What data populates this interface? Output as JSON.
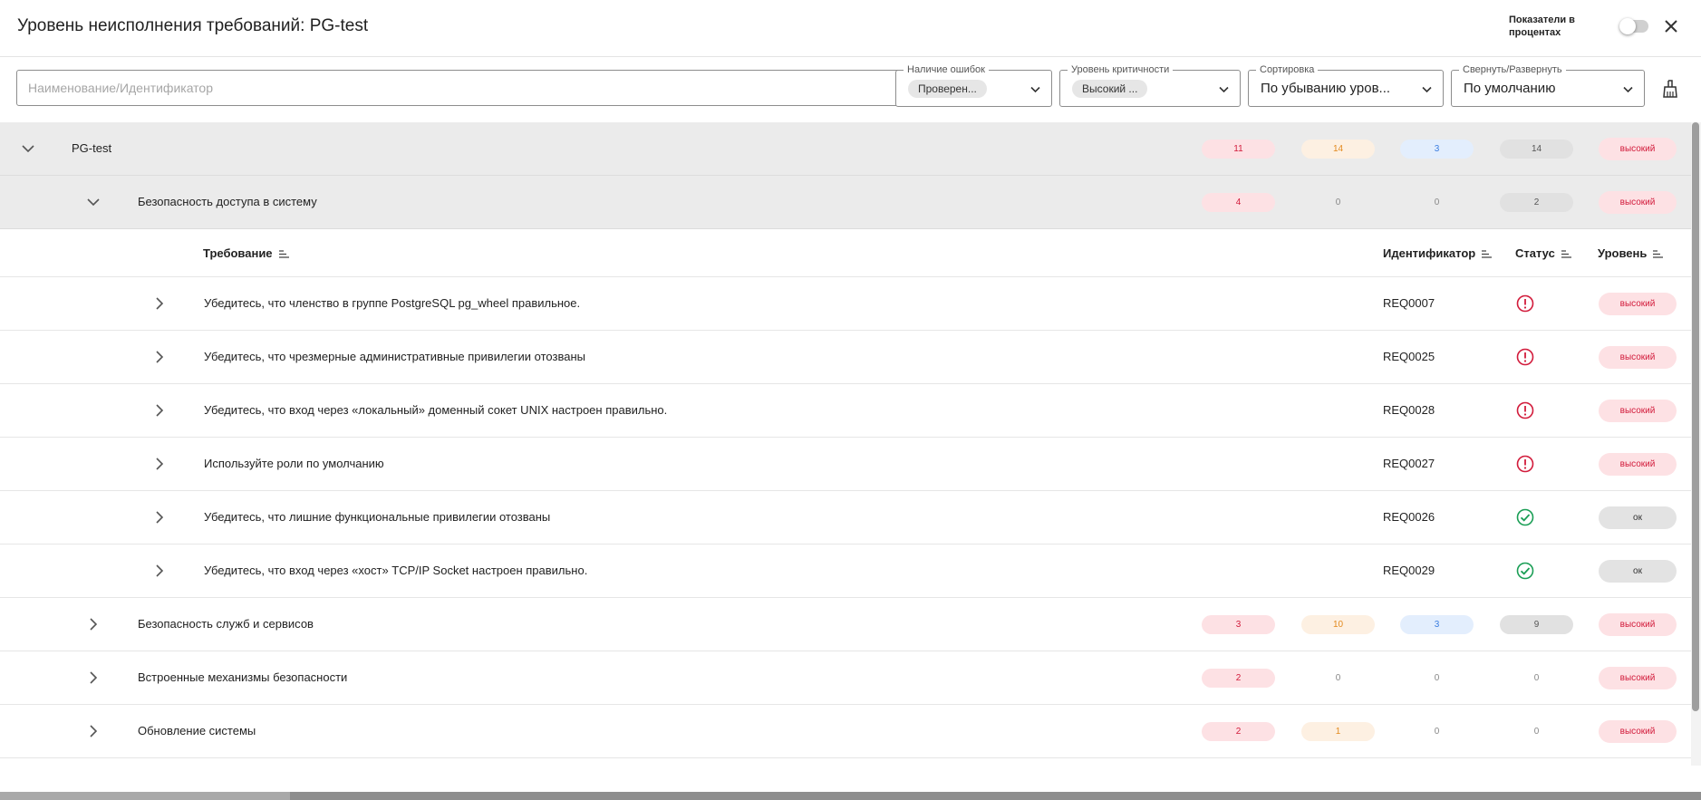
{
  "dialog": {
    "title": "Уровень неисполнения требований: PG-test",
    "percent_toggle_label": "Показатели в процентах",
    "percent_toggle_on": false
  },
  "filters": {
    "search_placeholder": "Наименование/Идентификатор",
    "errors": {
      "legend": "Наличие ошибок",
      "chip": "Проверен..."
    },
    "criticality": {
      "legend": "Уровень критичности",
      "chip": "Высокий ..."
    },
    "sort": {
      "legend": "Сортировка",
      "value": "По убыванию уров..."
    },
    "collapse": {
      "legend": "Свернуть/Развернуть",
      "value": "По умолчанию"
    }
  },
  "tree": {
    "root": {
      "label": "PG-test",
      "counts": [
        "11",
        "14",
        "3",
        "14"
      ],
      "level": "высокий"
    },
    "group1": {
      "label": "Безопасность доступа в систему",
      "counts": [
        "4",
        "0",
        "0",
        "2"
      ],
      "level": "высокий"
    },
    "columns": {
      "requirement": "Требование",
      "identifier": "Идентификатор",
      "status": "Статус",
      "level": "Уровень"
    },
    "requirements": [
      {
        "text": "Убедитесь, что членство в группе PostgreSQL pg_wheel правильное.",
        "id": "REQ0007",
        "status": "error",
        "level": "высокий"
      },
      {
        "text": "Убедитесь, что чрезмерные административные привилегии отозваны",
        "id": "REQ0025",
        "status": "error",
        "level": "высокий"
      },
      {
        "text": "Убедитесь, что вход через «локальный» доменный сокет UNIX настроен правильно.",
        "id": "REQ0028",
        "status": "error",
        "level": "высокий"
      },
      {
        "text": "Используйте роли по умолчанию",
        "id": "REQ0027",
        "status": "error",
        "level": "высокий"
      },
      {
        "text": "Убедитесь, что лишние функциональные привилегии отозваны",
        "id": "REQ0026",
        "status": "ok",
        "level": "ок"
      },
      {
        "text": "Убедитесь, что вход через «хост» TCP/IP Socket настроен правильно.",
        "id": "REQ0029",
        "status": "ok",
        "level": "ок"
      }
    ],
    "group2": {
      "label": "Безопасность служб и сервисов",
      "counts": [
        "3",
        "10",
        "3",
        "9"
      ],
      "level": "высокий"
    },
    "group3": {
      "label": "Встроенные механизмы безопасности",
      "counts": [
        "2",
        "0",
        "0",
        "0"
      ],
      "level": "высокий"
    },
    "group4": {
      "label": "Обновление системы",
      "counts": [
        "2",
        "1",
        "0",
        "0"
      ],
      "level": "высокий"
    }
  },
  "colors": {
    "error": "#d21b3b",
    "ok": "#1a9e55",
    "orange": "#e38a1e",
    "blue": "#3b7de0"
  }
}
